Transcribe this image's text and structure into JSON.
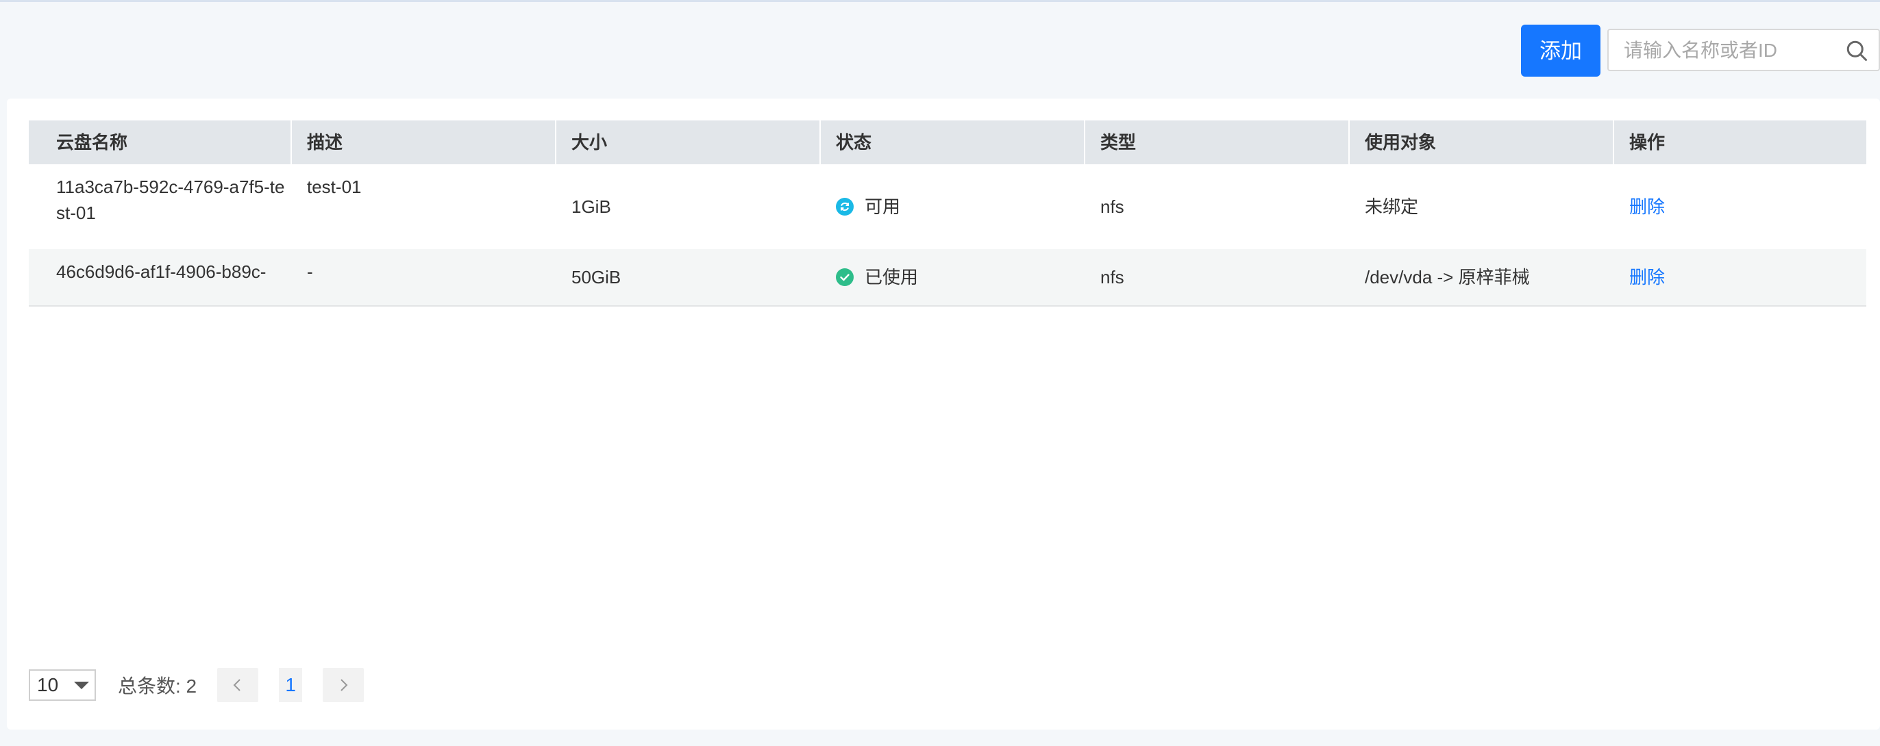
{
  "toolbar": {
    "add_label": "添加",
    "search_placeholder": "请输入名称或者ID",
    "search_value": ""
  },
  "table": {
    "columns": [
      "云盘名称",
      "描述",
      "大小",
      "状态",
      "类型",
      "使用对象",
      "操作"
    ],
    "rows": [
      {
        "name": "11a3ca7b-592c-4769-a7f5-test-01",
        "description": "test-01",
        "size": "1GiB",
        "status": "可用",
        "status_icon": "available-icon",
        "type": "nfs",
        "target": "未绑定",
        "action": "删除"
      },
      {
        "name": "46c6d9d6-af1f-4906-b89c-",
        "description": "-",
        "size": "50GiB",
        "status": "已使用",
        "status_icon": "in-use-check-icon",
        "type": "nfs",
        "target": "/dev/vda -> 原梓菲械",
        "action": "删除"
      }
    ]
  },
  "pagination": {
    "page_size": "10",
    "total_label": "总条数: 2",
    "current_page": "1"
  },
  "colors": {
    "primary": "#1677ff",
    "header_bg": "#e2e6ea",
    "available": "#1ab9e6",
    "in_use": "#2ebd8a"
  }
}
